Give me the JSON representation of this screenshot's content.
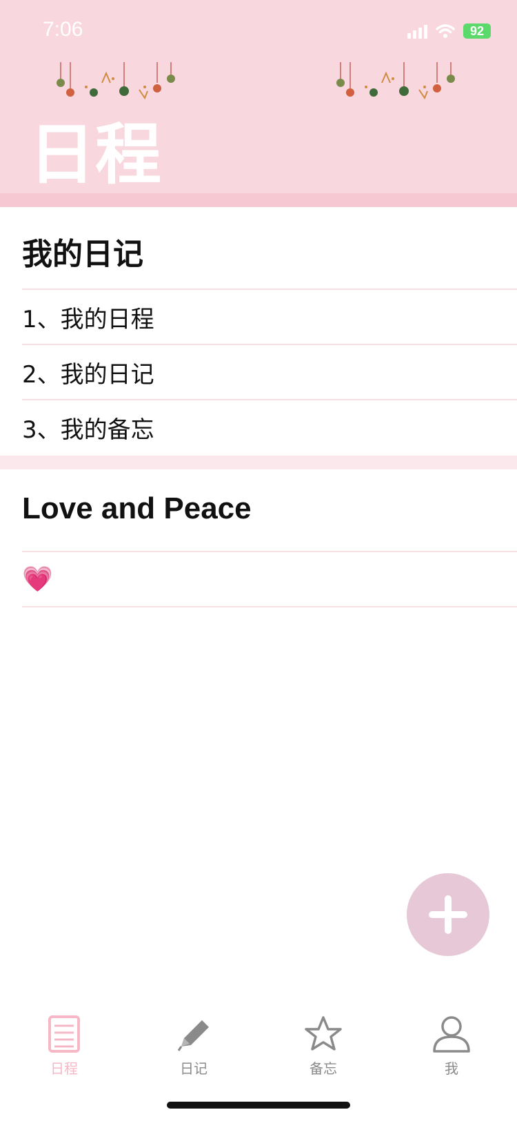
{
  "status_bar": {
    "time": "7:06",
    "battery": "92"
  },
  "header": {
    "title": "日程"
  },
  "diary_section": {
    "title": "我的日记",
    "items": [
      {
        "label": "1、我的日程"
      },
      {
        "label": "2、我的日记"
      },
      {
        "label": "3、我的备忘"
      }
    ]
  },
  "love_section": {
    "title": "Love and Peace",
    "emoji": "💗"
  },
  "tab_bar": {
    "tabs": [
      {
        "label": "日程",
        "icon": "calendar-list-icon",
        "active": true
      },
      {
        "label": "日记",
        "icon": "pencil-icon",
        "active": false
      },
      {
        "label": "备忘",
        "icon": "star-icon",
        "active": false
      },
      {
        "label": "我",
        "icon": "person-icon",
        "active": false
      }
    ]
  },
  "colors": {
    "header_bg": "#f8d8de",
    "accent_pink": "#f6c9d2",
    "fab": "#e6c8d6",
    "tab_active": "#f6b8c6",
    "tab_inactive": "#8a8a8a"
  }
}
